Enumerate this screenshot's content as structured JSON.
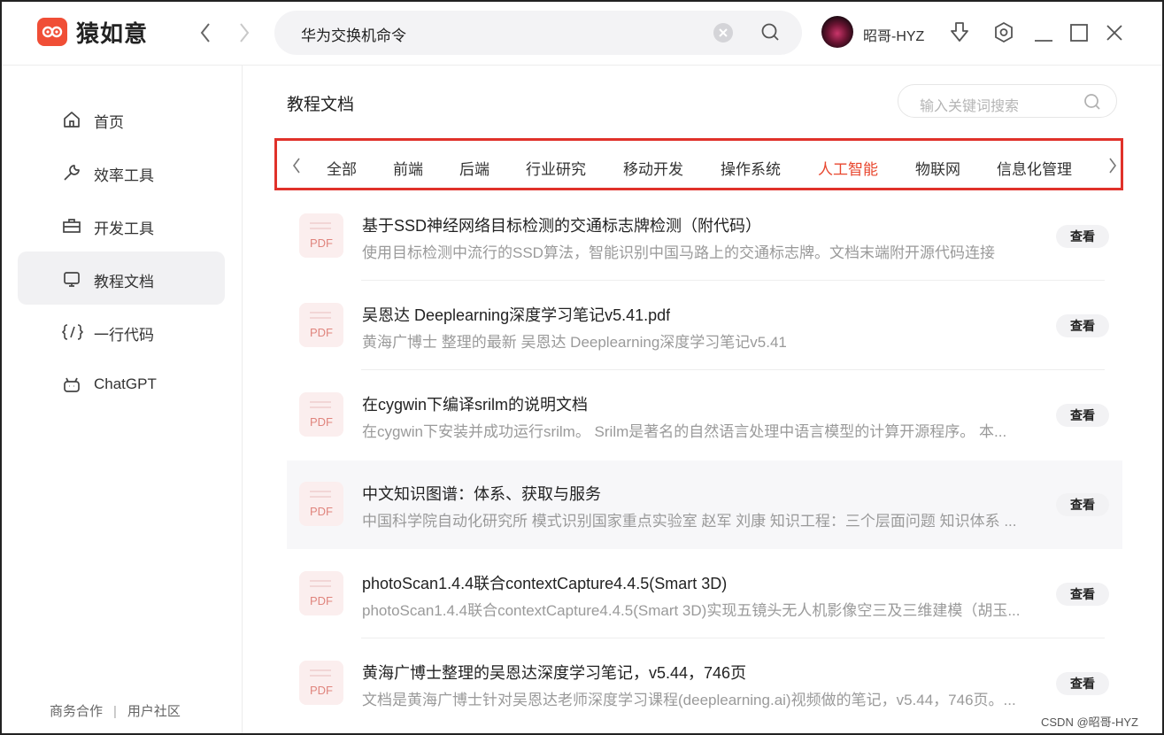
{
  "app": {
    "name": "猿如意",
    "search_query": "华为交换机命令",
    "user_name": "昭哥-HYZ"
  },
  "colors": {
    "brand": "#f04e36",
    "active_tab": "#e8472f",
    "highlight_border": "#e0312a"
  },
  "sidebar": {
    "items": [
      {
        "label": "首页",
        "icon": "home-icon"
      },
      {
        "label": "效率工具",
        "icon": "wrench-icon"
      },
      {
        "label": "开发工具",
        "icon": "toolbox-icon"
      },
      {
        "label": "教程文档",
        "icon": "document-screen-icon",
        "active": true
      },
      {
        "label": "一行代码",
        "icon": "code-braces-icon"
      },
      {
        "label": "ChatGPT",
        "icon": "robot-icon"
      }
    ],
    "footer": {
      "left": "商务合作",
      "separator": "|",
      "right": "用户社区"
    }
  },
  "main": {
    "title": "教程文档",
    "keyword_search_placeholder": "输入关键词搜索",
    "tabs": [
      "全部",
      "前端",
      "后端",
      "行业研究",
      "移动开发",
      "操作系统",
      "人工智能",
      "物联网",
      "信息化管理"
    ],
    "active_tab": "人工智能",
    "view_label": "查看",
    "file_type": "PDF",
    "docs": [
      {
        "title": "基于SSD神经网络目标检测的交通标志牌检测（附代码）",
        "desc": "使用目标检测中流行的SSD算法，智能识别中国马路上的交通标志牌。文档末端附开源代码连接"
      },
      {
        "title": "吴恩达 Deeplearning深度学习笔记v5.41.pdf",
        "desc": "黄海广博士 整理的最新 吴恩达 Deeplearning深度学习笔记v5.41"
      },
      {
        "title": "在cygwin下编译srilm的说明文档",
        "desc": "在cygwin下安装并成功运行srilm。 Srilm是著名的自然语言处理中语言模型的计算开源程序。 本..."
      },
      {
        "title": "中文知识图谱：体系、获取与服务",
        "desc": "中国科学院自动化研究所 模式识别国家重点实验室 赵军 刘康 知识工程：三个层面问题 知识体系 ..."
      },
      {
        "title": "photoScan1.4.4联合contextCapture4.4.5(Smart 3D)",
        "desc": "photoScan1.4.4联合contextCapture4.4.5(Smart 3D)实现五镜头无人机影像空三及三维建模（胡玉..."
      },
      {
        "title": "黄海广博士整理的吴恩达深度学习笔记，v5.44，746页",
        "desc": "文档是黄海广博士针对吴恩达老师深度学习课程(deeplearning.ai)视频做的笔记，v5.44，746页。..."
      }
    ]
  },
  "watermark": "CSDN @昭哥-HYZ"
}
